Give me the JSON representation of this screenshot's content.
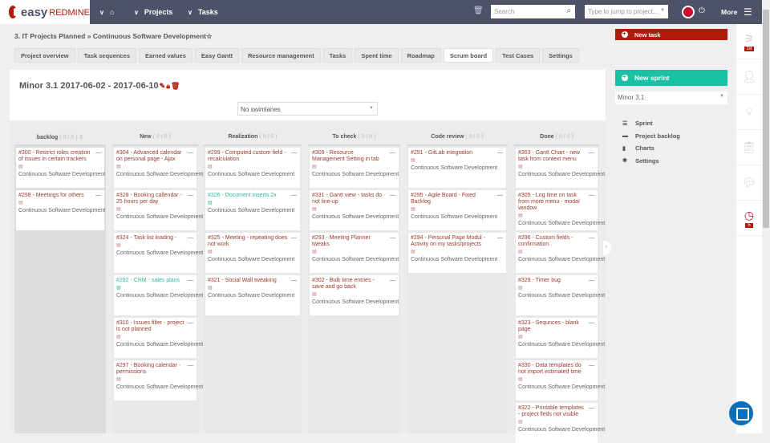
{
  "topbar": {
    "logo_easy": "easy",
    "logo_redmine": "REDMINE",
    "home_icon": "⌂",
    "nav_projects": "Projects",
    "nav_tasks": "Tasks",
    "search_placeholder": "Search",
    "jump_placeholder": "Type to jump to project...",
    "more": "More"
  },
  "breadcrumb": "3. IT Projects Planned » Continuous Software Development☆",
  "tabs": [
    "Project overview",
    "Task sequences",
    "Earned values",
    "Easy Gantt",
    "Resource management",
    "Tasks",
    "Spent time",
    "Roadmap",
    "Scrum board",
    "Test Cases",
    "Settings"
  ],
  "active_tab": "Scrum board",
  "sprint_title": "Minor 3.1 2017-06-02 - 2017-06-10",
  "swimlane_select": "No swimlanes",
  "project_name": "Continuous Software Development",
  "columns": [
    {
      "name": "backlog",
      "count": "( 0 / 0 )",
      "cards": [
        {
          "title": "#300 - Restrict roles creation of issues in certain trackers"
        },
        {
          "title": "#298 - Meetings for others"
        }
      ]
    },
    {
      "name": "New",
      "count": "( 0 / 0 )",
      "cards": [
        {
          "title": "#304 - Advanced calendar on personal page - Ajax"
        },
        {
          "title": "#328 - Booking callendar - 25 hours per day"
        },
        {
          "title": "#324 - Task list loading -"
        },
        {
          "title": "#292 - CRM - sales plans",
          "teal": true
        },
        {
          "title": "#310 - Issues filter - project is not planned"
        },
        {
          "title": "#297 - Booking calendar - permissions"
        }
      ]
    },
    {
      "name": "Realization",
      "count": "( 0 / 0 )",
      "cards": [
        {
          "title": "#299 - Computed custom field - recalculation"
        },
        {
          "title": "#326 - Document inserts 2x",
          "teal": true
        },
        {
          "title": "#325 - Meeting - repeating does not work"
        },
        {
          "title": "#321 - Social Wall tweaking"
        }
      ]
    },
    {
      "name": "To check",
      "count": "( 0 / 0 )",
      "cards": [
        {
          "title": "#309 - Resource Management Setting in tab"
        },
        {
          "title": "#331 - Gantt view - tasks do not line-up"
        },
        {
          "title": "#293 - Meeting Planner tweaks"
        },
        {
          "title": "#302 - Bulk time entries - save and go back"
        }
      ]
    },
    {
      "name": "Code review",
      "count": "( 0 / 0 )",
      "cards": [
        {
          "title": "#291 - GitLab integration"
        },
        {
          "title": "#295 - Agile Board - Fixed Backlog"
        },
        {
          "title": "#294 - Personal Page Modul - Activity on my tasks/projects"
        }
      ]
    },
    {
      "name": "Done",
      "count": "( 0 / 0 )",
      "cards": [
        {
          "title": "#303 - Gantt Chart - new task from context menu"
        },
        {
          "title": "#305 - Log time on task from more menu - modal window"
        },
        {
          "title": "#296 - Custom fields - confirmation"
        },
        {
          "title": "#329 - Timer bug"
        },
        {
          "title": "#323 - Sequnces - blank page"
        },
        {
          "title": "#330 - Data templates do not import estimated time"
        },
        {
          "title": "#322 - Printable templates - project fleds not visible"
        }
      ]
    }
  ],
  "sidebar": {
    "new_task": "New task",
    "new_sprint": "New sprint",
    "sprint_select": "Minor 3.1",
    "menu": [
      {
        "icon": "☰",
        "label": "Sprint"
      },
      {
        "icon": "▬",
        "label": "Project backlog"
      },
      {
        "icon": "▮",
        "label": "Charts"
      },
      {
        "icon": "✱",
        "label": "Settings"
      }
    ]
  },
  "strip": {
    "activity_badge": "18",
    "timer_badge": "5"
  },
  "colors": {
    "topbar": "#4d5269",
    "brand_red": "#b01c0b",
    "teal": "#17c3a2"
  }
}
